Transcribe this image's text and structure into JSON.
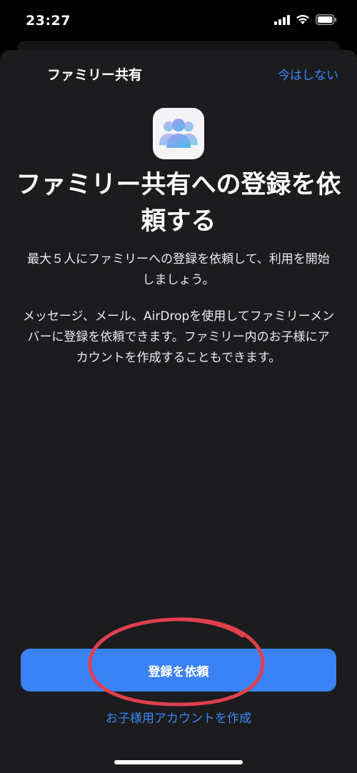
{
  "status_bar": {
    "time": "23:27",
    "icons": [
      "cellular-signal-icon",
      "wifi-icon",
      "battery-icon"
    ]
  },
  "nav": {
    "title": "ファミリー共有",
    "cancel_label": "今はしない"
  },
  "hero": {
    "icon": "family-sharing-icon",
    "headline": "ファミリー共有への登録を依頼する"
  },
  "body": {
    "paragraph_1": "最大５人にファミリーへの登録を依頼して、利用を開始しましょう。",
    "paragraph_2": "メッセージ、メール、AirDropを使用してファミリーメンバーに登録を依頼できます。ファミリー内のお子様にアカウントを作成することもできます。"
  },
  "actions": {
    "primary_label": "登録を依頼",
    "secondary_label": "お子様用アカウントを作成"
  },
  "colors": {
    "accent": "#3a82f6",
    "sheet_background": "#1c1c1e",
    "annotation_red": "#e0404e"
  }
}
